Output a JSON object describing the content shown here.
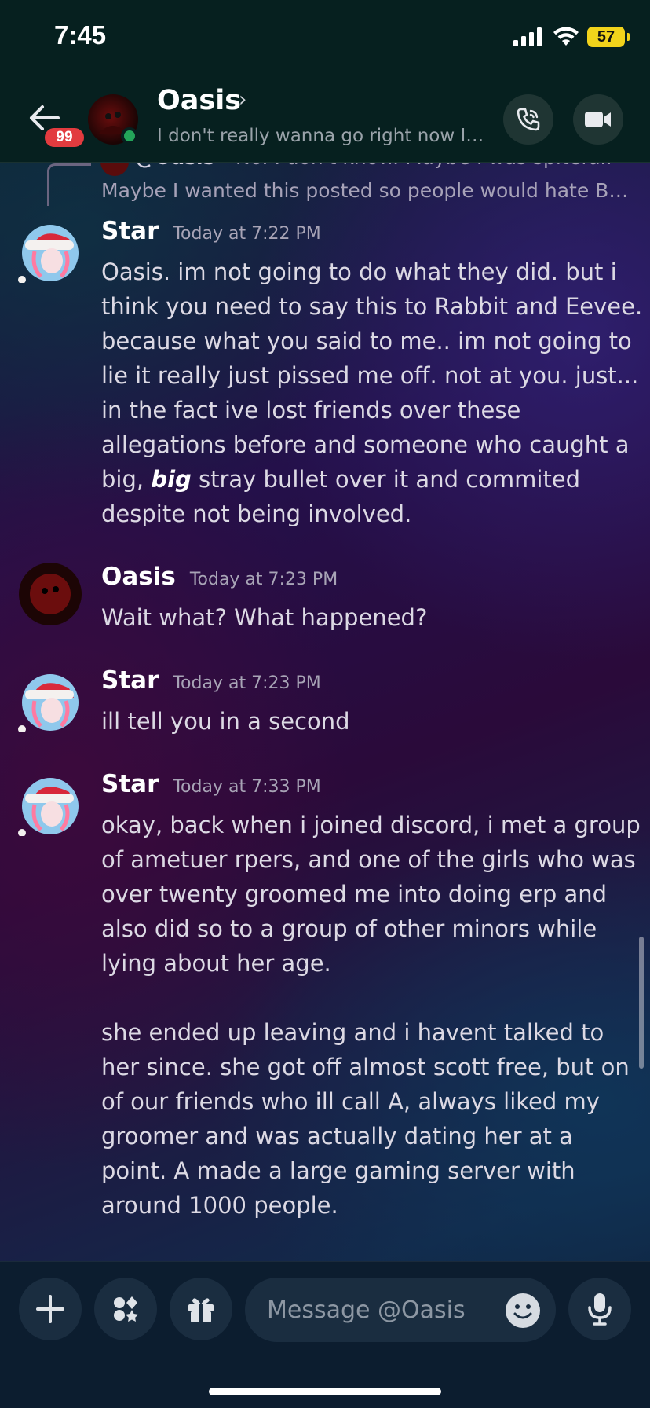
{
  "status_bar": {
    "time": "7:45",
    "battery": "57"
  },
  "header": {
    "badge_count": "99",
    "name": "Oasis",
    "chevron": "›",
    "status_text": "I don't really wanna go right now I jus..."
  },
  "reply_preview": {
    "author": "@Oasis",
    "text_line1": "No. I don't know. Maybe I was spiteful.",
    "text_line2": "Maybe I wanted this posted so people would hate Bone..."
  },
  "messages": [
    {
      "author": "Star",
      "timestamp": "Today at 7:22 PM",
      "text_before": "Oasis. im not going to do what they did. but i think you need to say this to Rabbit and Eevee. because what you said to me.. im not going to lie it really just pissed me off. not at you. just... in the fact ive lost friends over these allegations before and someone who caught a big, ",
      "text_emphasis": "big",
      "text_after": " stray bullet over it and commited despite not being involved."
    },
    {
      "author": "Oasis",
      "timestamp": "Today at 7:23 PM",
      "text": "Wait what? What happened?"
    },
    {
      "author": "Star",
      "timestamp": "Today at 7:23 PM",
      "text": "ill tell you in a second"
    },
    {
      "author": "Star",
      "timestamp": "Today at 7:33 PM",
      "para1": "okay, back when i joined discord, i met a group of ametuer rpers, and one of the girls who was over twenty groomed me into doing erp and also did so to a group of other minors while lying about her age.",
      "para2": "she ended up leaving and i havent talked to her since. she got off almost scott free, but on of our friends who ill call A,  always liked my groomer and was actually dating her at a point. A made a large gaming server with around 1000 people."
    }
  ],
  "composer": {
    "placeholder": "Message @Oasis"
  },
  "colors": {
    "online": "#23a55a",
    "badge": "#e23b3f",
    "battery": "#f2d31b"
  }
}
